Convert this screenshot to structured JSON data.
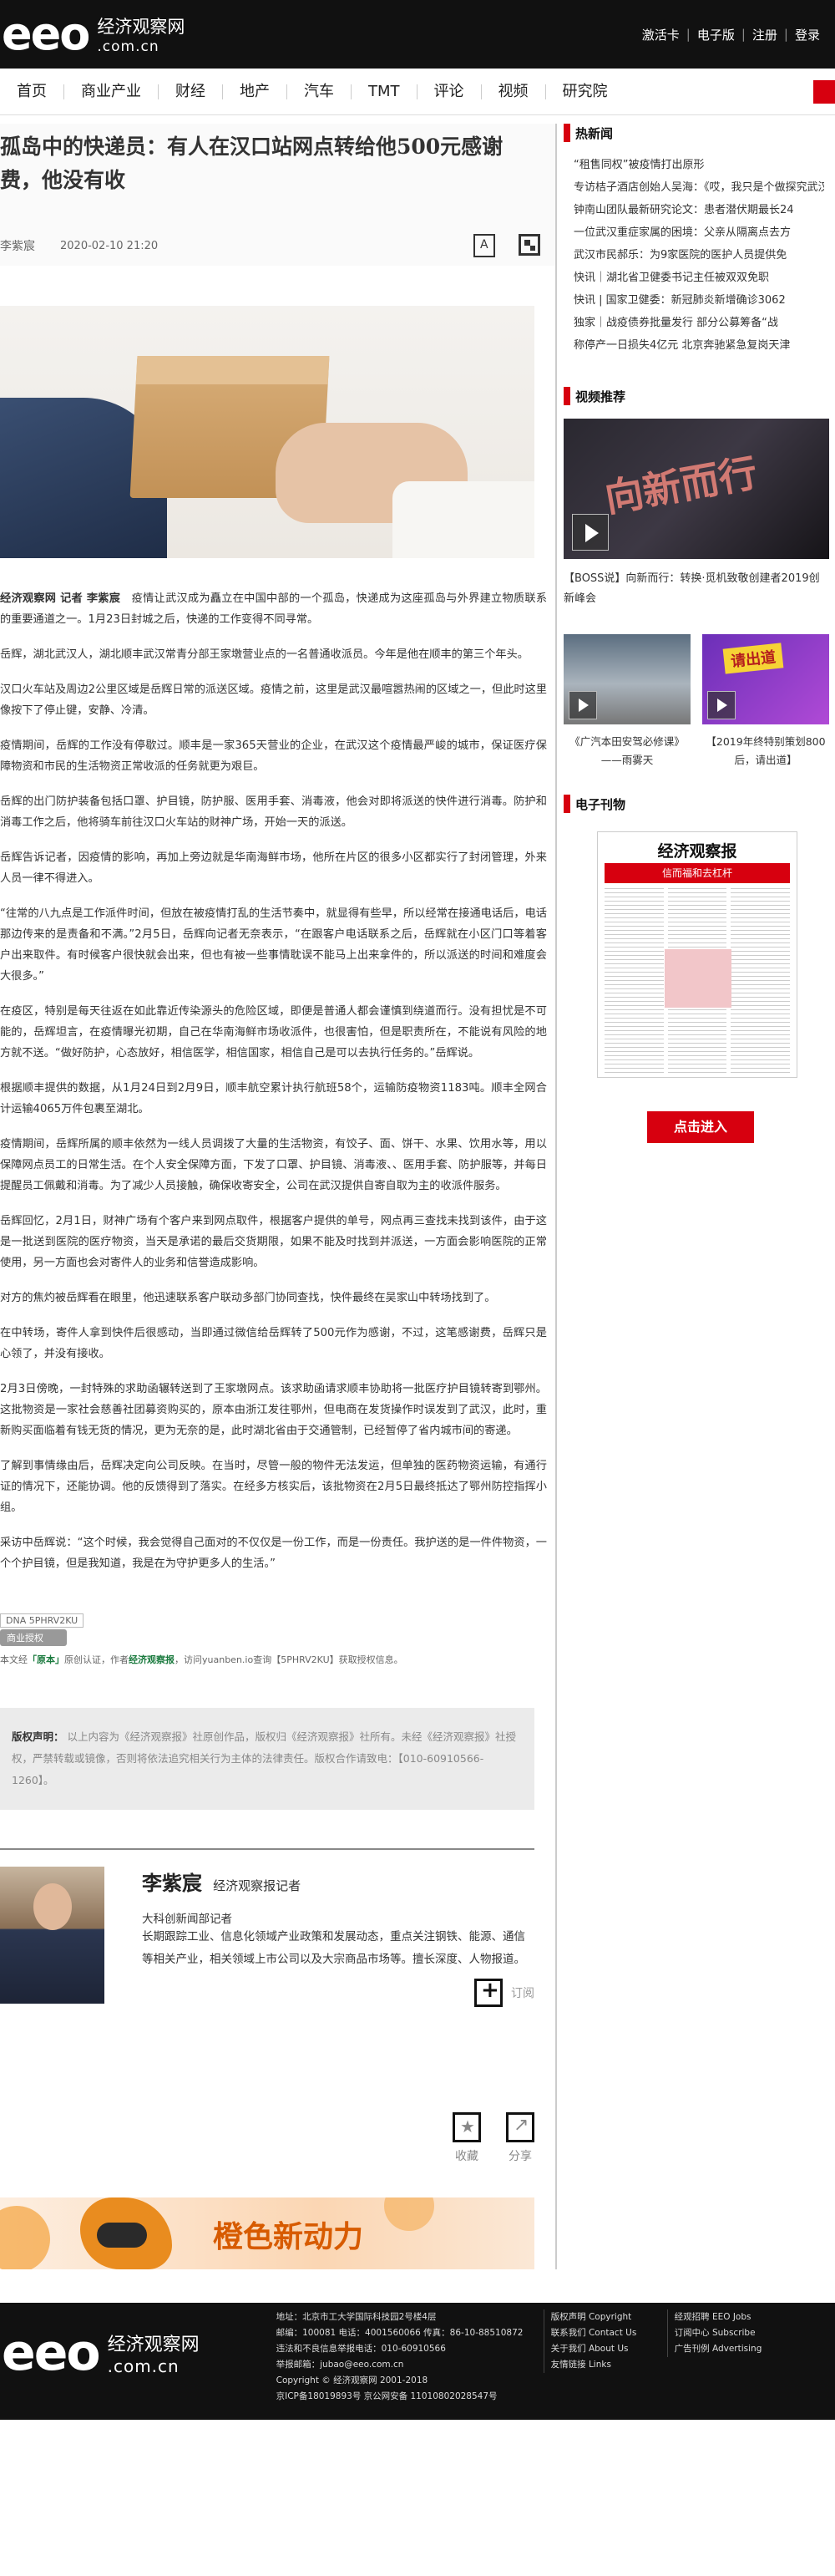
{
  "header": {
    "logo_mark": "eeo",
    "logo_cn": "经济观察网",
    "logo_url": ".com.cn",
    "links": [
      "激活卡",
      "电子版",
      "注册",
      "登录"
    ]
  },
  "nav": [
    "首页",
    "商业产业",
    "财经",
    "地产",
    "汽车",
    "TMT",
    "评论",
    "视频",
    "研究院"
  ],
  "article": {
    "title": "孤岛中的快递员：有人在汉口站网点转给他500元感谢费，他没有收",
    "author": "李紫宸",
    "date": "2020-02-10 21:20",
    "lead_source": "经济观察网 记者 李紫宸",
    "lead_text": "疫情让武汉成为矗立在中国中部的一个孤岛，快递成为这座孤岛与外界建立物质联系的重要通道之一。1月23日封城之后，快递的工作变得不同寻常。",
    "paragraphs": [
      "岳辉，湖北武汉人，湖北顺丰武汉常青分部王家墩营业点的一名普通收派员。今年是他在顺丰的第三个年头。",
      "汉口火车站及周边2公里区域是岳辉日常的派送区域。疫情之前，这里是武汉最喧嚣热闹的区域之一，但此时这里像按下了停止键，安静、冷清。",
      "疫情期间，岳辉的工作没有停歇过。顺丰是一家365天营业的企业，在武汉这个疫情最严峻的城市，保证医疗保障物资和市民的生活物资正常收派的任务就更为艰巨。",
      "岳辉的出门防护装备包括口罩、护目镜，防护服、医用手套、消毒液，他会对即将派送的快件进行消毒。防护和消毒工作之后，他将骑车前往汉口火车站的财神广场，开始一天的派送。",
      "岳辉告诉记者，因疫情的影响，再加上旁边就是华南海鲜市场，他所在片区的很多小区都实行了封闭管理，外来人员一律不得进入。",
      "“往常的八九点是工作派件时间，但放在被疫情打乱的生活节奏中，就显得有些早，所以经常在接通电话后，电话那边传来的是责备和不满。”2月5日，岳辉向记者无奈表示，“在跟客户电话联系之后，岳辉就在小区门口等着客户出来取件。有时候客户很快就会出来，但也有被一些事情耽误不能马上出来拿件的，所以派送的时间和难度会大很多。”",
      "在疫区，特别是每天往返在如此靠近传染源头的危险区域，即便是普通人都会谨慎到绕道而行。没有担忧是不可能的，岳辉坦言，在疫情曝光初期，自己在华南海鲜市场收派件，也很害怕，但是职责所在，不能说有风险的地方就不送。“做好防护，心态放好，相信医学，相信国家，相信自己是可以去执行任务的。”岳辉说。",
      "根据顺丰提供的数据，从1月24日到2月9日，顺丰航空累计执行航班58个，运输防疫物资1183吨。顺丰全网合计运输4065万件包裹至湖北。",
      "疫情期间，岳辉所属的顺丰依然为一线人员调拨了大量的生活物资，有饺子、面、饼干、水果、饮用水等，用以保障网点员工的日常生活。在个人安全保障方面，下发了口罩、护目镜、消毒液、、医用手套、防护服等，并每日提醒员工佩戴和消毒。为了减少人员接触，确保收寄安全，公司在武汉提供自寄自取为主的收派件服务。",
      "岳辉回忆，2月1日，财神广场有个客户来到网点取件，根据客户提供的单号，网点再三查找未找到该件，由于这是一批送到医院的医疗物资，当天是承诺的最后交货期限，如果不能及时找到并派送，一方面会影响医院的正常使用，另一方面也会对寄件人的业务和信誉造成影响。",
      "对方的焦灼被岳辉看在眼里，他迅速联系客户联动多部门协同查找，快件最终在吴家山中转场找到了。",
      "在中转场，寄件人拿到快件后很感动，当即通过微信给岳辉转了500元作为感谢，不过，这笔感谢费，岳辉只是心领了，并没有接收。",
      "2月3日傍晚，一封特殊的求助函辗转送到了王家墩网点。该求助函请求顺丰协助将一批医疗护目镜转寄到鄂州。这批物资是一家社会慈善社团募资购买的，原本由浙江发往鄂州，但电商在发货操作时误发到了武汉，此时，重新购买面临着有钱无货的情况，更为无奈的是，此时湖北省由于交通管制，已经暂停了省内城市间的寄递。",
      "了解到事情缘由后，岳辉决定向公司反映。在当时，尽管一般的物件无法发运，但单独的医药物资运输，有通行证的情况下，还能协调。他的反馈得到了落实。在经多方核实后，该批物资在2月5日最终抵达了鄂州防控指挥小组。",
      "采访中岳辉说：“这个时候，我会觉得自己面对的不仅仅是一份工作，而是一份责任。我护送的是一件件物资，一个个护目镜，但是我知道，我是在为守护更多人的生活。”"
    ],
    "dna_code": "DNA 5PHRV2KU",
    "auth_btn": "商业授权",
    "source_line_pre": "本文经",
    "source_brand": "「原本」",
    "source_line_mid": "原创认证，作者",
    "source_author": "经济观察报",
    "source_line_post": "，访问yuanben.io查询【5PHRV2KU】获取授权信息。",
    "copyright_label": "版权声明：",
    "copyright_text": "以上内容为《经济观察报》社原创作品，版权归《经济观察报》社所有。未经《经济观察报》社授权，严禁转载或镜像，否则将依法追究相关行为主体的法律责任。版权合作请致电：【010-60910566-1260】。"
  },
  "author_card": {
    "name": "李紫宸",
    "role": "经济观察报记者",
    "org": "大科创新闻部记者",
    "bio": "长期跟踪工业、信息化领域产业政策和发展动态，重点关注钢铁、能源、通信等相关产业，相关领域上市公司以及大宗商品市场等。擅长深度、人物报道。",
    "subscribe": "订阅"
  },
  "actions": {
    "favorite": "收藏",
    "share": "分享"
  },
  "banner": {
    "text": "橙色新动力"
  },
  "sidebar": {
    "hot_title": "热新闻",
    "hot_items": [
      "“租售同权”被疫情打出原形",
      "专访桔子酒店创始人吴海：《哎，我只是个做探究武汉疫情医护感染",
      "钟南山团队最新研究论文：患者潜伏期最长24",
      "一位武汉重症家属的困境：父亲从隔离点去方",
      "武汉市民郝乐：为9家医院的医护人员提供免",
      "快讯｜湖北省卫健委书记主任被双双免职",
      "快讯 | 国家卫健委：新冠肺炎新增确诊3062",
      "独家｜战疫债券批量发行 部分公募筹备“战",
      "称停产一日损失4亿元 北京奔驰紧急复岗天津"
    ],
    "video_title": "视频推荐",
    "video_main_art": "向新而行",
    "video_main_caption": "【BOSS说】向新而行：转换·觅机致敬创建者2019创新峰会",
    "video_small": [
      {
        "caption": "《广汽本田安驾必修课》——雨雾天"
      },
      {
        "caption": "【2019年终特别策划800后，请出道】",
        "label": "请出道"
      }
    ],
    "epaper_title": "电子刊物",
    "epaper_name": "经济观察报",
    "epaper_headline": "信而福和去杠杆",
    "enter_btn": "点击进入"
  },
  "footer": {
    "logo_mark": "eeo",
    "logo_cn": "经济观察网",
    "logo_url": ".com.cn",
    "col1": [
      "地址：北京市工大学国际科技园2号楼4层",
      "邮编：100081 电话：4001560066 传真：86-10-88510872",
      "违法和不良信息举报电话：010-60910566",
      "举报邮箱：jubao@eeo.com.cn",
      "Copyright © 经济观察网 2001-2018",
      "京ICP备18019893号    京公网安备 11010802028547号"
    ],
    "col2": [
      "版权声明 Copyright",
      "联系我们 Contact Us",
      "关于我们 About Us",
      "友情链接 Links"
    ],
    "col3": [
      "经观招聘 EEO Jobs",
      "订阅中心 Subscribe",
      "广告刊例 Advertising"
    ]
  },
  "colors": {
    "accent": "#d7000f",
    "header_bg": "#111111"
  }
}
